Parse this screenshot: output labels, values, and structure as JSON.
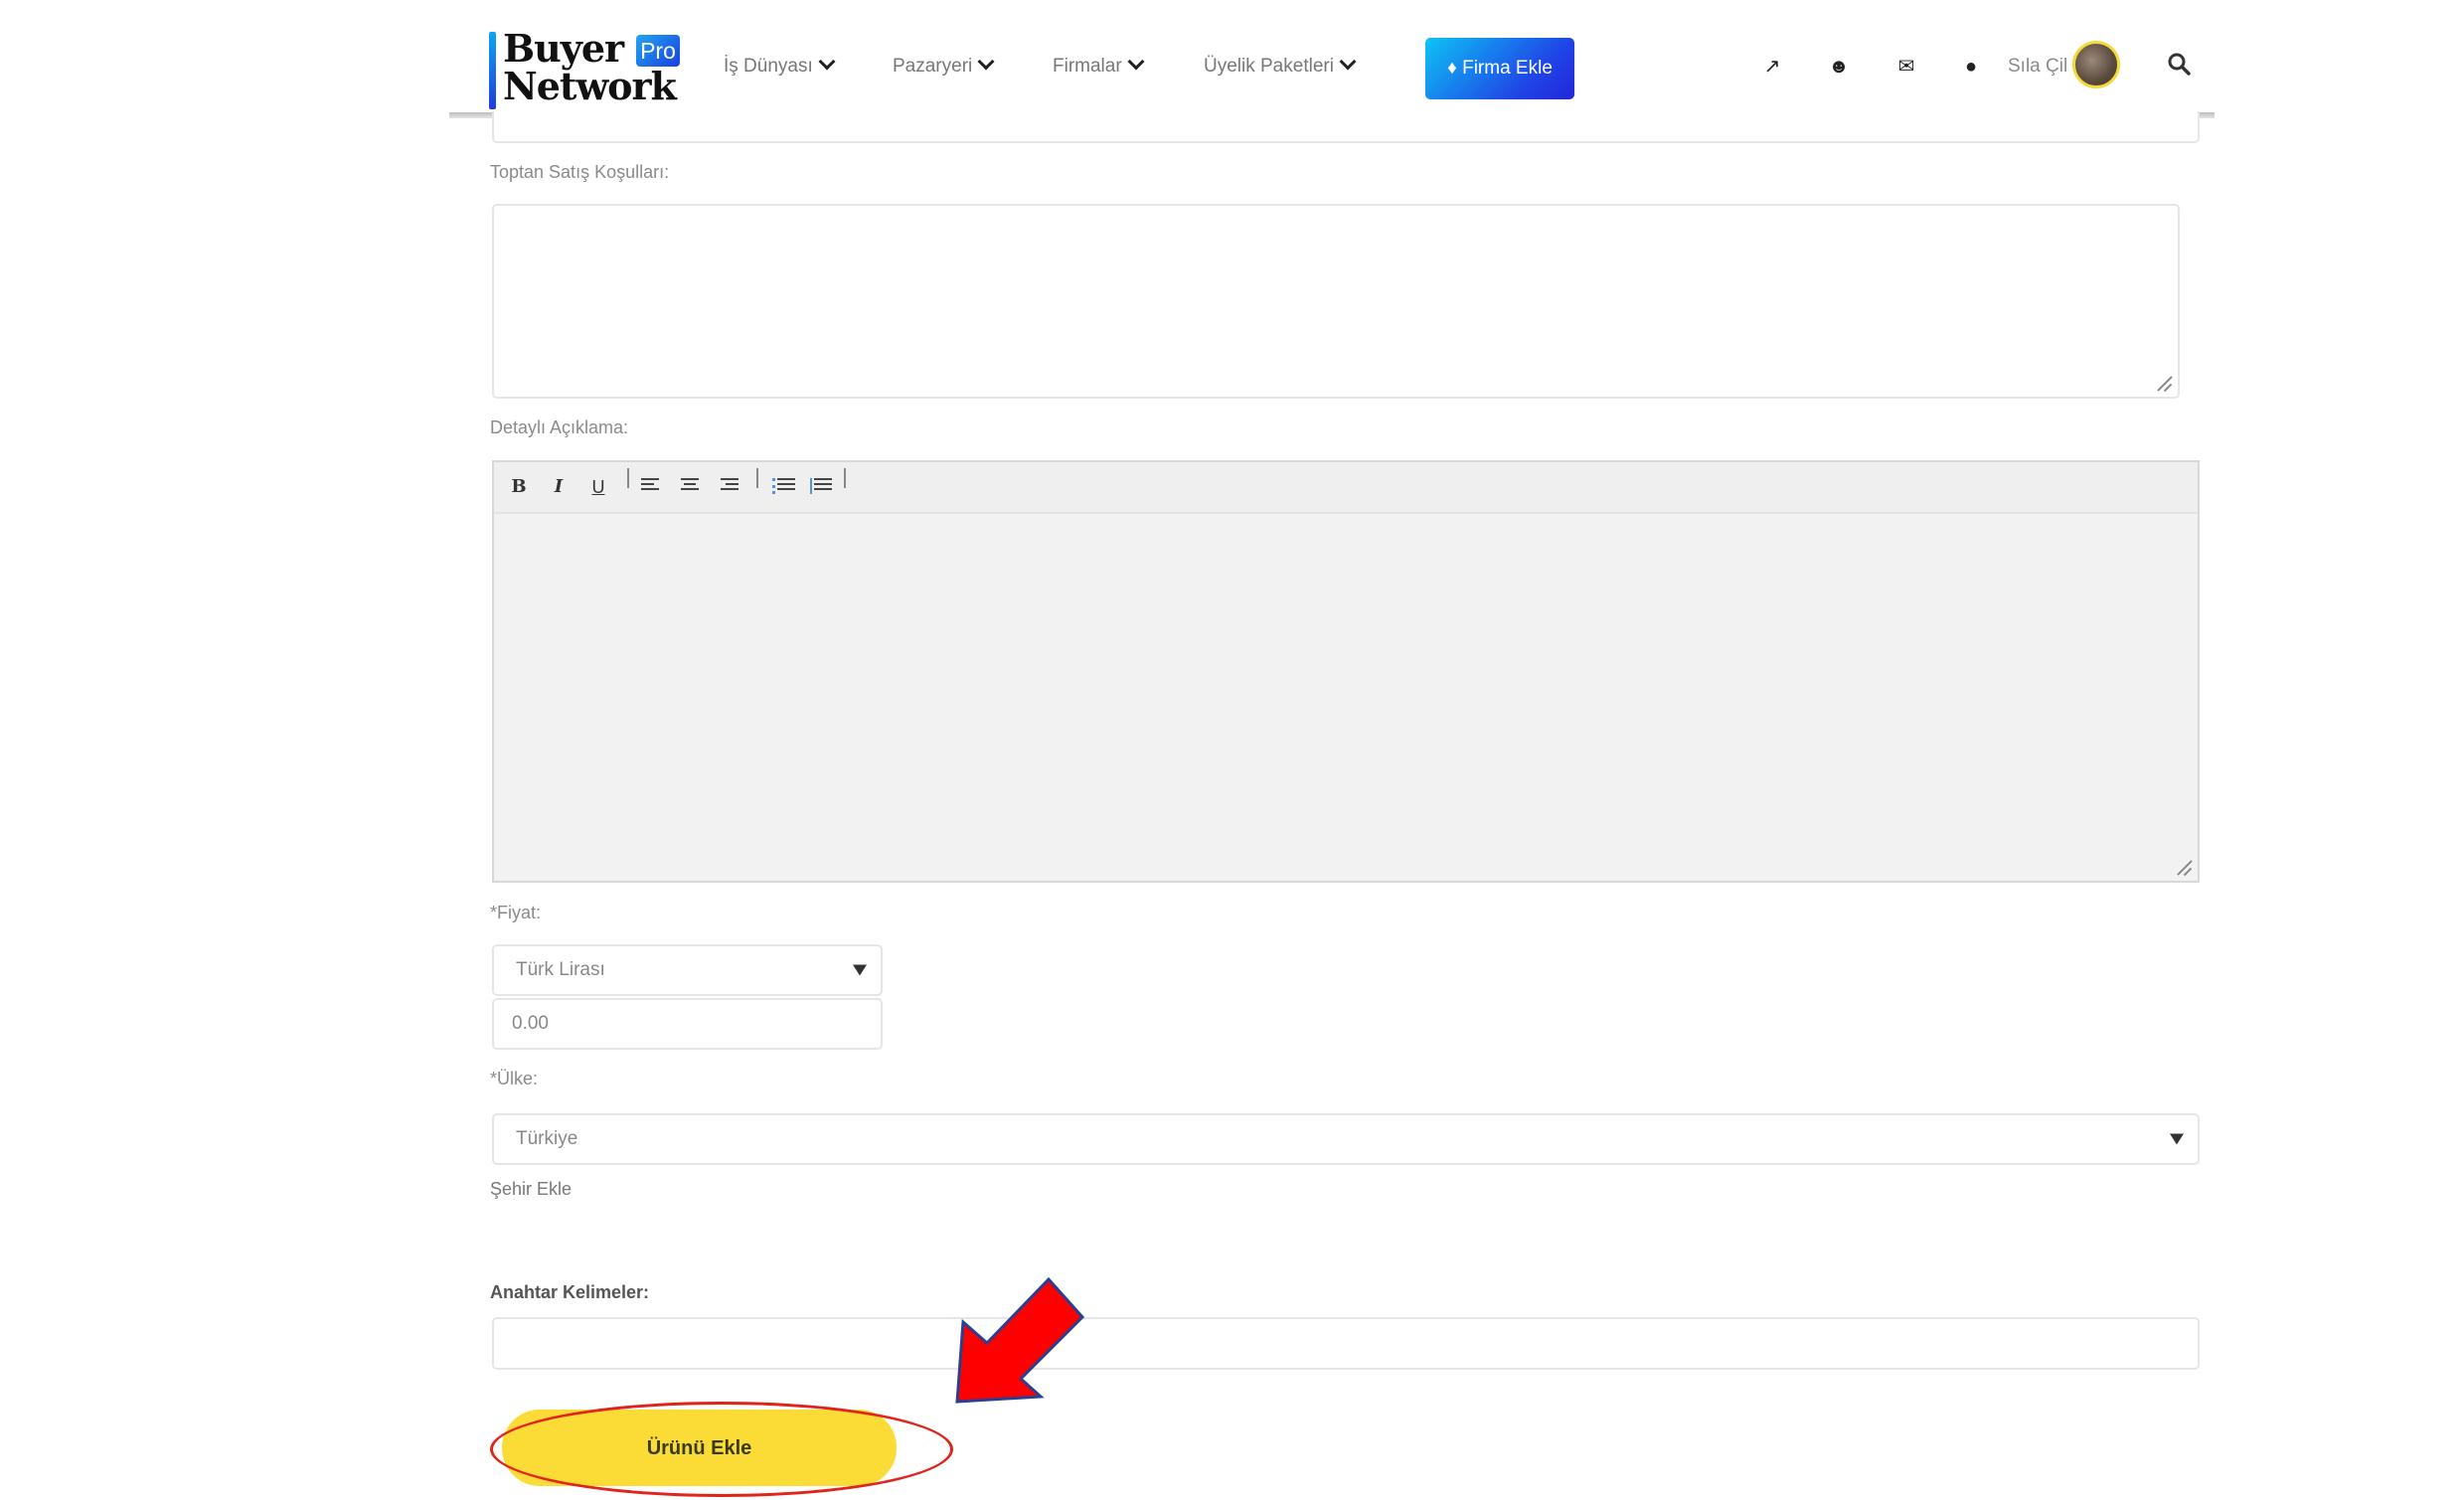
{
  "header": {
    "logo": {
      "line1": "Buyer",
      "line2": "Network",
      "badge": "Pro"
    },
    "nav": [
      {
        "label": "İş Dünyası",
        "icon": "chevron-down-icon"
      },
      {
        "label": "Pazaryeri",
        "icon": "chevron-down-icon"
      },
      {
        "label": "Firmalar",
        "icon": "chevron-down-icon"
      },
      {
        "label": "Üyelik Paketleri",
        "icon": "chevron-down-icon"
      }
    ],
    "cta": {
      "label": "Firma Ekle",
      "icon": "diamond-icon",
      "gradient_from": "#0ec3f5",
      "gradient_to": "#2326d8"
    },
    "icons": [
      {
        "name": "external-link-icon",
        "glyph": "↗"
      },
      {
        "name": "users-icon",
        "glyph": "👥"
      },
      {
        "name": "envelope-icon",
        "glyph": "✉"
      },
      {
        "name": "globe-icon",
        "glyph": "🌐"
      }
    ],
    "user": {
      "name": "Sıla Çil",
      "avatar_border": "#f3d93a"
    },
    "search_icon": "search-icon"
  },
  "form": {
    "wholesale_label": "Toptan Satış Koşulları:",
    "wholesale_value": "",
    "description_label": "Detaylı Açıklama:",
    "editor_toolbar": [
      {
        "name": "bold-button",
        "glyph": "B"
      },
      {
        "name": "italic-button",
        "glyph": "I"
      },
      {
        "name": "underline-button",
        "glyph": "U"
      },
      {
        "name": "align-left-button"
      },
      {
        "name": "align-center-button"
      },
      {
        "name": "align-right-button"
      },
      {
        "name": "bullet-list-button"
      },
      {
        "name": "numbered-list-button"
      }
    ],
    "description_value": "",
    "price_label": "*Fiyat:",
    "currency_selected": "Türk Lirası",
    "price_value": "0.00",
    "country_label": "*Ülke:",
    "country_selected": "Türkiye",
    "add_city_link": "Şehir Ekle",
    "keywords_label": "Anahtar Kelimeler:",
    "keywords_value": "",
    "submit_label": "Ürünü Ekle",
    "submit_color": "#fbdc37"
  },
  "annotation": {
    "highlight_color": "#e2231a",
    "arrow_fill": "#ff0000",
    "arrow_stroke": "#2a3f8f"
  }
}
